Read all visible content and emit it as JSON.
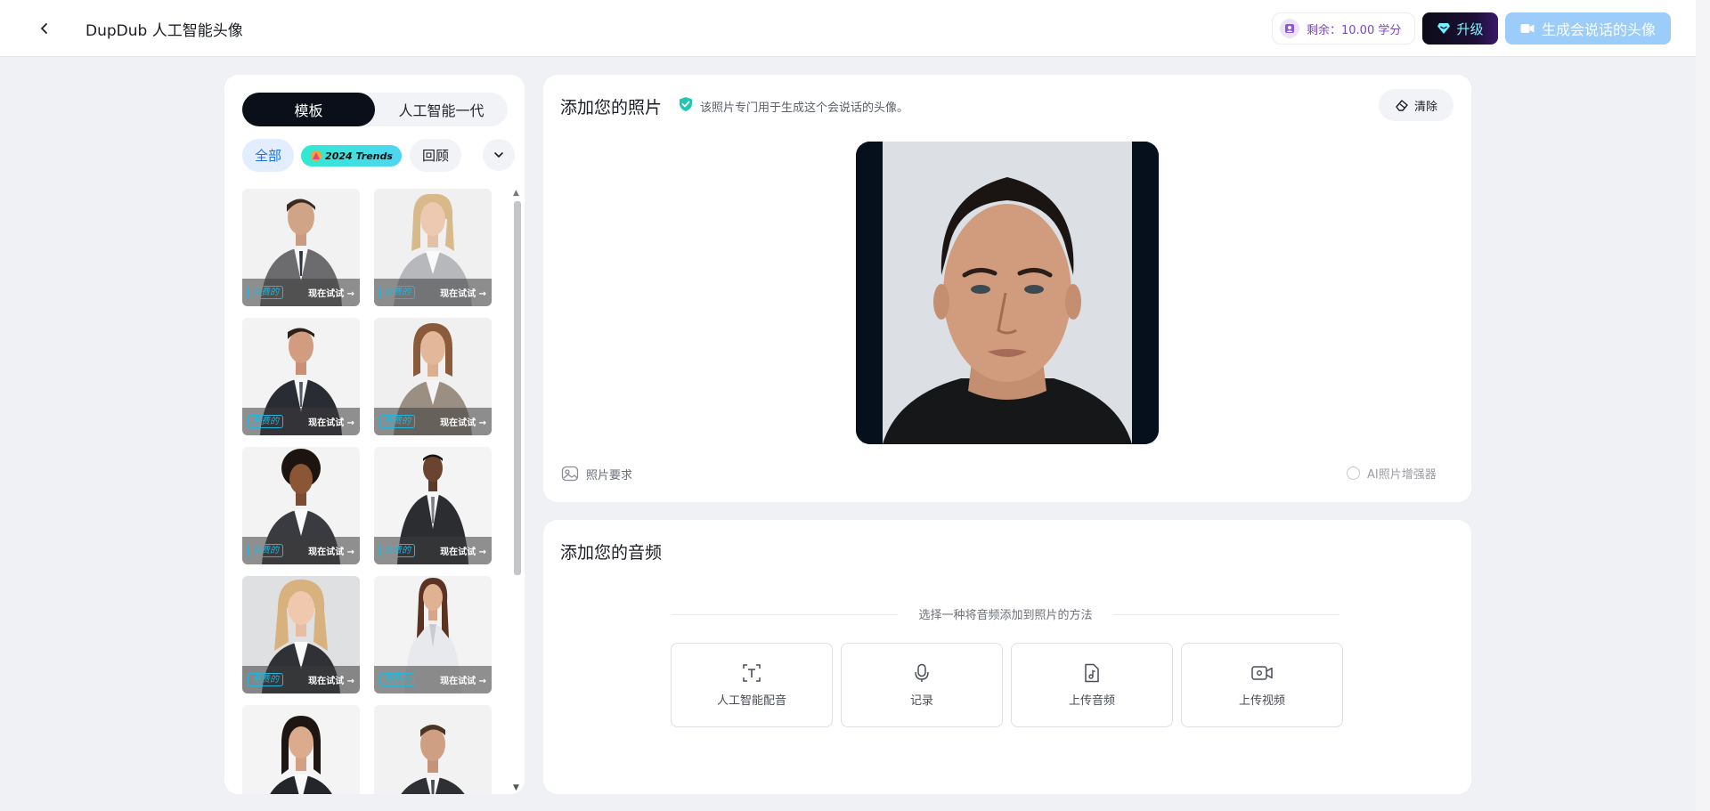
{
  "header": {
    "title": "DupDub 人工智能头像",
    "credits_label": "剩余：10.00 学分",
    "upgrade_label": "升级",
    "generate_label": "生成会说话的头像"
  },
  "sidebar": {
    "tabs": [
      "模板",
      "人工智能一代"
    ],
    "active_tab": "模板",
    "filters": {
      "all": "全部",
      "trends": "2024 Trends",
      "retro": "回顾"
    },
    "card_try_label": "现在试试 →",
    "cards": [
      {
        "tag": "免费的"
      },
      {
        "tag": "免费的"
      },
      {
        "tag": "免费的"
      },
      {
        "tag": "免费的"
      },
      {
        "tag": "免费的"
      },
      {
        "tag": "免费的"
      },
      {
        "tag": "免费的"
      },
      {
        "tag": "免费的"
      },
      {
        "tag": ""
      },
      {
        "tag": ""
      }
    ]
  },
  "photo_panel": {
    "title": "添加您的照片",
    "note": "该照片专门用于生成这个会说话的头像。",
    "clear_label": "清除",
    "requirements_label": "照片要求",
    "enhancer_label": "AI照片增强器"
  },
  "audio_panel": {
    "title": "添加您的音频",
    "subtitle": "选择一种将音频添加到照片的方法",
    "options": [
      {
        "label": "人工智能配音",
        "icon": "text-to-speech-icon"
      },
      {
        "label": "记录",
        "icon": "microphone-icon"
      },
      {
        "label": "上传音频",
        "icon": "music-file-icon"
      },
      {
        "label": "上传视频",
        "icon": "video-camera-icon"
      }
    ]
  },
  "colors": {
    "accent_blue": "#1b72e8",
    "generate_button": "#9cccf9",
    "upgrade_text": "#7ff6ff",
    "credit_purple": "#7b46c5",
    "free_tag": "#22b6dd"
  }
}
